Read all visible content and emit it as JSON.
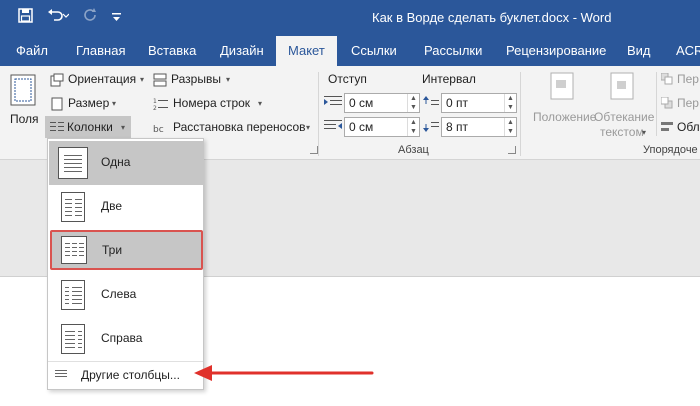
{
  "window": {
    "doc_title": "Как в Ворде сделать буклет.docx - Word"
  },
  "qat": {
    "save_icon": "save-icon",
    "undo_icon": "undo-icon",
    "redo_icon": "redo-icon",
    "customize_icon": "customize-qat-icon"
  },
  "tabs": [
    {
      "label": "Файл"
    },
    {
      "label": "Главная"
    },
    {
      "label": "Вставка"
    },
    {
      "label": "Дизайн"
    },
    {
      "label": "Макет",
      "active": true
    },
    {
      "label": "Ссылки"
    },
    {
      "label": "Рассылки"
    },
    {
      "label": "Рецензирование"
    },
    {
      "label": "Вид"
    },
    {
      "label": "ACR"
    }
  ],
  "ribbon": {
    "fields_label": "Поля",
    "orientation_label": "Ориентация",
    "size_label": "Размер",
    "columns_label": "Колонки",
    "breaks_label": "Разрывы",
    "line_numbers_label": "Номера строк",
    "hyphenation_label": "Расстановка переносов",
    "indent_title": "Отступ",
    "indent_left": "0 см",
    "indent_right": "0 см",
    "spacing_title": "Интервал",
    "spacing_before": "0 пт",
    "spacing_after": "8 пт",
    "paragraph_group": "Абзац",
    "position_label": "Положение",
    "wrap_label_1": "Обтекание",
    "wrap_label_2": "текстом",
    "forward_label": "Пер",
    "backward_label": "Пер",
    "align_label": "Обл",
    "arrange_group": "Упорядоче"
  },
  "columns_menu": {
    "items": [
      {
        "label": "Одна",
        "columns": 1
      },
      {
        "label": "Две",
        "columns": 2
      },
      {
        "label": "Три",
        "columns": 3
      },
      {
        "label": "Слева",
        "columns": "left"
      },
      {
        "label": "Справа",
        "columns": "right"
      }
    ],
    "more_label": "Другие столбцы..."
  },
  "colors": {
    "title_bar": "#2b579a",
    "ribbon_bg": "#f3f3f3",
    "highlight_border": "#d9534f",
    "arrow": "#e0312b"
  }
}
